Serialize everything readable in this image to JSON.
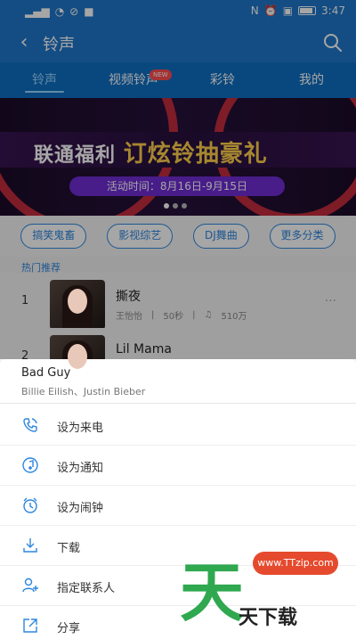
{
  "statusbar": {
    "time": "3:47"
  },
  "header": {
    "title": "铃声"
  },
  "tabs": [
    {
      "label": "铃声",
      "active": true
    },
    {
      "label": "视频铃声",
      "badge": "NEW"
    },
    {
      "label": "彩铃"
    },
    {
      "label": "我的"
    }
  ],
  "banner": {
    "headline_prefix": "联通福利",
    "headline_highlight": "订炫铃抽豪礼",
    "activity_time": "活动时间：8月16日-9月15日"
  },
  "categories": [
    "搞笑鬼畜",
    "影视综艺",
    "DJ舞曲",
    "更多分类"
  ],
  "section": {
    "title": "热门推荐"
  },
  "songs": [
    {
      "rank": "1",
      "title": "撕夜",
      "artist": "王怡怡",
      "duration": "50秒",
      "plays": "510万"
    },
    {
      "rank": "2",
      "title": "Lil Mama"
    }
  ],
  "sheet": {
    "song_title": "Bad Guy",
    "song_artists": "Billie Eilish、Justin Bieber",
    "actions": [
      {
        "icon": "phone-ring-icon",
        "label": "设为来电"
      },
      {
        "icon": "music-note-icon",
        "label": "设为通知"
      },
      {
        "icon": "alarm-clock-icon",
        "label": "设为闹钟"
      },
      {
        "icon": "download-icon",
        "label": "下载"
      },
      {
        "icon": "person-add-icon",
        "label": "指定联系人"
      },
      {
        "icon": "share-icon",
        "label": "分享"
      }
    ]
  },
  "watermark": {
    "url": "www.TTzip.com",
    "big_char": "天",
    "small_text": "天下载"
  },
  "colors": {
    "primary": "#1f77c9",
    "accent": "#2e86de",
    "watermark_green": "#2fa84f",
    "watermark_red": "#e64a2e"
  }
}
